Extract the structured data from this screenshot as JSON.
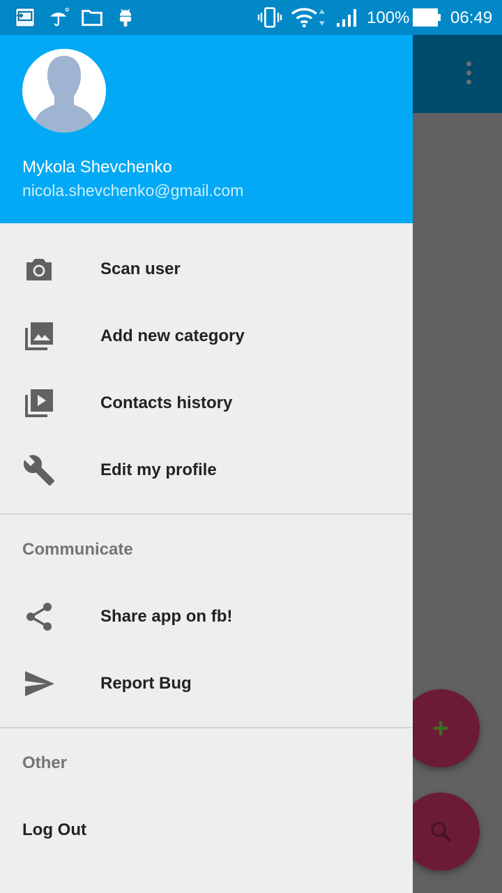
{
  "status_bar": {
    "battery_percent": "100%",
    "time": "06:49",
    "icons": [
      "screen-cast-icon",
      "umbrella-icon",
      "folder-icon",
      "android-icon",
      "vibrate-icon",
      "wifi-icon",
      "signal-icon",
      "battery-icon"
    ]
  },
  "drawer": {
    "header": {
      "name": "Mykola Shevchenko",
      "email": "nicola.shevchenko@gmail.com"
    },
    "items": [
      {
        "label": "Scan user",
        "icon": "camera-icon"
      },
      {
        "label": "Add new category",
        "icon": "photo-library-icon"
      },
      {
        "label": "Contacts history",
        "icon": "video-library-icon"
      },
      {
        "label": "Edit my profile",
        "icon": "wrench-icon"
      }
    ],
    "communicate": {
      "title": "Communicate",
      "items": [
        {
          "label": "Share app on fb!",
          "icon": "share-icon"
        },
        {
          "label": "Report Bug",
          "icon": "send-icon"
        }
      ]
    },
    "other": {
      "title": "Other",
      "items": [
        {
          "label": "Log Out"
        }
      ]
    }
  },
  "app": {
    "fab_add_symbol": "+",
    "icons": [
      "overflow-menu-icon",
      "search-icon"
    ]
  },
  "colors": {
    "status_bar": "#0288c7",
    "header": "#03a9f4",
    "drawer_bg": "#eeeeee",
    "fab": "#6c1b36"
  }
}
